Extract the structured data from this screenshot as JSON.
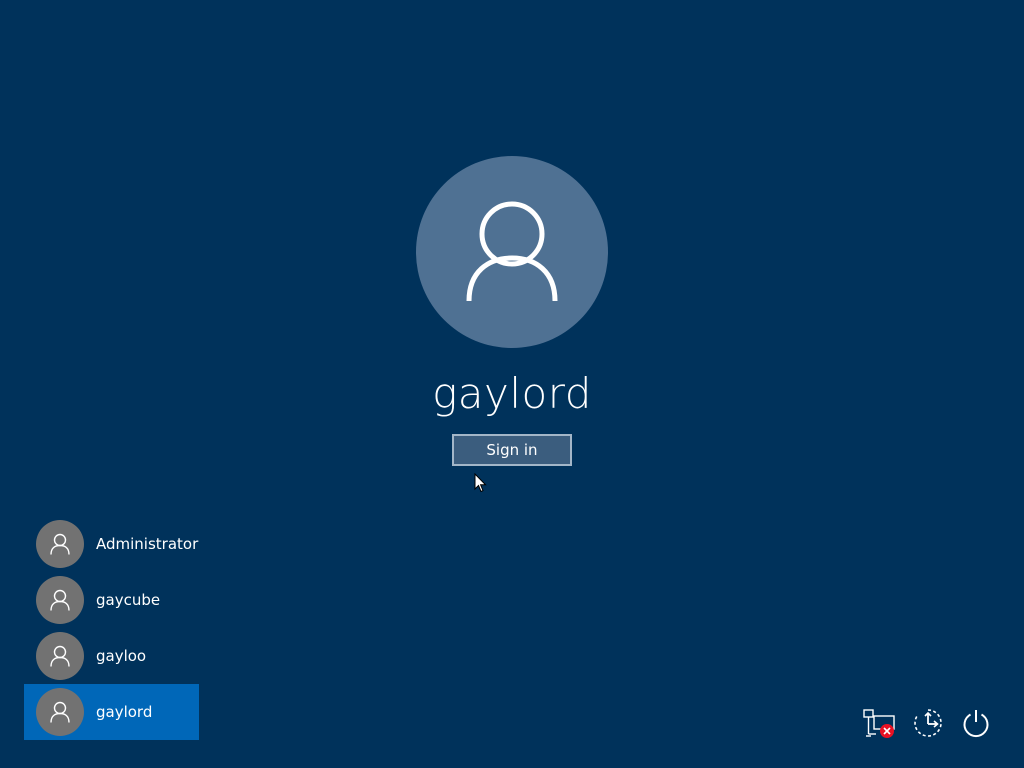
{
  "profile": {
    "username": "gaylord",
    "sign_in_label": "Sign in"
  },
  "users": [
    {
      "name": "Administrator",
      "selected": false
    },
    {
      "name": "gaycube",
      "selected": false
    },
    {
      "name": "gayloo",
      "selected": false
    },
    {
      "name": "gaylord",
      "selected": true
    }
  ],
  "system_icons": [
    "network-disconnected-icon",
    "ease-of-access-icon",
    "power-icon"
  ],
  "colors": {
    "background": "#00325b",
    "avatar_large": "#4f7193",
    "avatar_small": "#727272",
    "selected_item": "#0067b8",
    "error_badge": "#e81123"
  }
}
